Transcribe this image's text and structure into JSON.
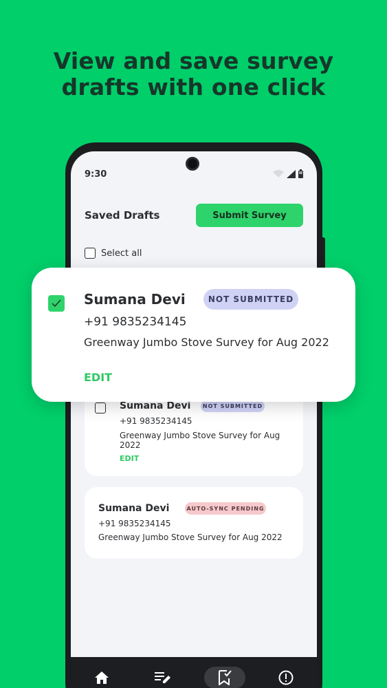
{
  "headline": {
    "line1": "View and save survey",
    "line2": "drafts with one click"
  },
  "status_bar": {
    "time": "9:30"
  },
  "header": {
    "title": "Saved Drafts",
    "submit_label": "Submit Survey"
  },
  "select_all_label": "Select all",
  "highlight_card": {
    "name": "Sumana Devi",
    "badge": "NOT SUBMITTED",
    "phone": "+91 9835234145",
    "survey": "Greenway Jumbo Stove Survey for Aug 2022",
    "edit_label": "EDIT",
    "checked": true
  },
  "cards": [
    {
      "name": "Sumana Devi",
      "badge": "NOT SUBMITTED",
      "phone": "+91 9835234145",
      "survey": "Greenway Jumbo Stove Survey for Aug 2022",
      "edit_label": "EDIT"
    },
    {
      "name": "Sumana Devi",
      "badge": "AUTO-SYNC PENDING",
      "phone": "+91 9835234145",
      "survey": "Greenway Jumbo Stove Survey for Aug 2022"
    }
  ],
  "nav": [
    "home-icon",
    "edit-list-icon",
    "drafts-icon",
    "info-icon"
  ],
  "colors": {
    "background": "#00cf6a",
    "accent": "#2fd36b",
    "badge_not_submitted": "#d0d2f5",
    "badge_sync_pending": "#f6c9cc"
  }
}
